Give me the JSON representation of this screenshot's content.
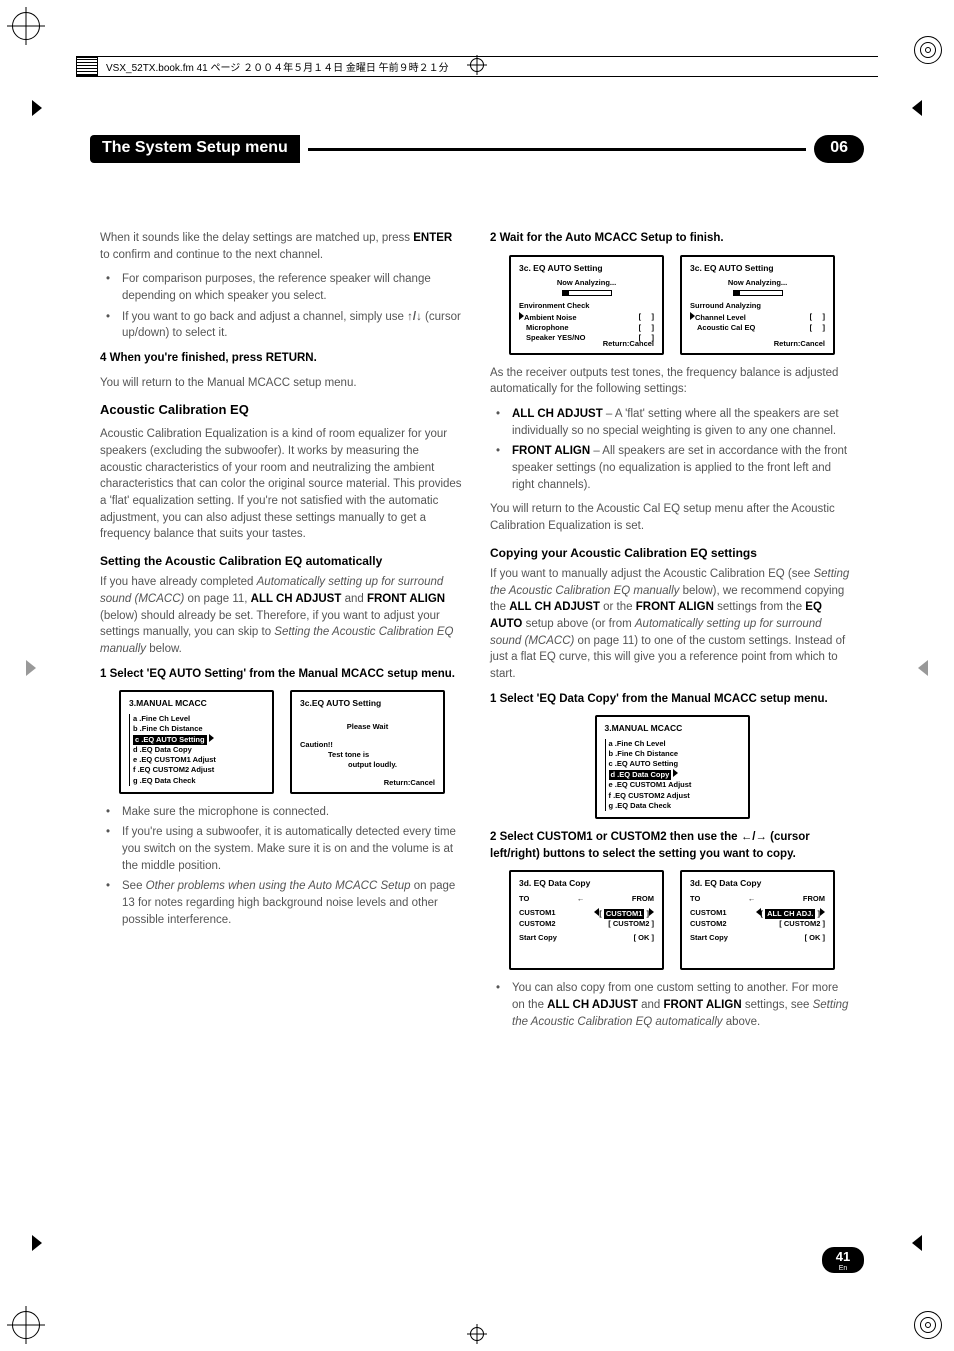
{
  "topstrip": "VSX_52TX.book.fm 41 ページ ２００４年５月１４日 金曜日 午前９時２１分",
  "title": "The System Setup menu",
  "chapter": "06",
  "pagenum": "41",
  "pagelang": "En",
  "left": {
    "intro1": "When it sounds like the delay settings are matched up, press ",
    "intro1b": "ENTER",
    "intro1c": " to confirm and continue to the next channel.",
    "b1": "For comparison purposes, the reference speaker will change depending on which speaker you select.",
    "b2a": "If you want to go back and adjust a channel, simply use ",
    "b2b": " (cursor up/down) to select it.",
    "s4": "4   When you're finished, press RETURN.",
    "s4p": "You will return to the Manual MCACC setup menu.",
    "h1": "Acoustic Calibration EQ",
    "p1": "Acoustic Calibration Equalization is a kind of room equalizer for your speakers (excluding the subwoofer). It works by measuring the acoustic characteristics of your room and neutralizing the ambient characteristics that can color the original source material. This provides a 'flat' equalization setting. If you're not satisfied with the automatic adjustment, you can also adjust these settings manually to get a frequency balance that suits your tastes.",
    "h2": "Setting the Acoustic Calibration EQ automatically",
    "p2a": "If you have already completed ",
    "p2b": "Automatically setting up for surround sound (MCACC)",
    "p2c": " on page 11, ",
    "p2d": "ALL CH ADJUST",
    "p2e": " and ",
    "p2f": "FRONT ALIGN",
    "p2g": " (below) should already be set. Therefore, if you want to adjust your settings manually, you can skip to ",
    "p2h": "Setting the Acoustic Calibration EQ manually",
    "p2i": " below.",
    "s1": "1   Select 'EQ AUTO Setting' from the Manual MCACC setup menu.",
    "scrA": {
      "title": "3.MANUAL MCACC",
      "a": "a .Fine Ch Level",
      "b": "b .Fine Ch Distance",
      "c": "c .EQ AUTO Setting",
      "d": "d .EQ Data Copy",
      "e": "e .EQ CUSTOM1 Adjust",
      "f": "f .EQ CUSTOM2 Adjust",
      "g": "g .EQ Data Check"
    },
    "scrB": {
      "title": "3c.EQ AUTO Setting",
      "wait": "Please Wait",
      "caution": "Caution!!",
      "t1": "Test tone is",
      "t2": "output loudly.",
      "ret": "Return:Cancel"
    },
    "b3": "Make sure the microphone is connected.",
    "b4": "If you're using a subwoofer, it is automatically detected every time you switch on the system. Make sure it is on and the volume is at the middle position.",
    "b5a": "See ",
    "b5b": "Other problems when using the Auto MCACC Setup",
    "b5c": " on page 13 for notes regarding high background noise levels and other possible interference."
  },
  "right": {
    "s2": "2   Wait for the Auto MCACC Setup to finish.",
    "scrC": {
      "title": "3c. EQ AUTO Setting",
      "now": "Now Analyzing...",
      "l1": "Environment Check",
      "l2": "Ambient Noise",
      "l3": "Microphone",
      "l4": "Speaker YES/NO",
      "ret": "Return:Cancel"
    },
    "scrD": {
      "title": "3c. EQ AUTO Setting",
      "now": "Now Analyzing...",
      "l1": "Surround Analyzing",
      "l2": "Channel Level",
      "l3": "Acoustic Cal EQ",
      "ret": "Return:Cancel"
    },
    "p1": "As the receiver outputs test tones, the frequency balance is adjusted automatically for the following settings:",
    "b1a": "ALL CH ADJUST",
    "b1b": " – A 'flat' setting where all the speakers are set individually so no special weighting is given to any one channel.",
    "b2a": "FRONT ALIGN",
    "b2b": " – All speakers are set in accordance with the front speaker settings (no equalization is applied to the front left and right channels).",
    "p2": "You will return to the Acoustic Cal EQ setup menu after the Acoustic Calibration Equalization is set.",
    "h1": "Copying your Acoustic Calibration EQ settings",
    "p3a": "If you want to manually adjust the Acoustic Calibration EQ (see ",
    "p3b": "Setting the Acoustic Calibration EQ manually",
    "p3c": " below), we recommend copying the ",
    "p3d": "ALL CH ADJUST",
    "p3e": " or the ",
    "p3f": "FRONT ALIGN",
    "p3g": " settings from the ",
    "p3h": "EQ AUTO",
    "p3i": " setup above (or from ",
    "p3j": "Automatically setting up for surround sound (MCACC)",
    "p3k": " on page 11) to one of the custom settings. Instead of just a flat EQ curve, this will give you a reference point from which to start.",
    "s1b": "1   Select 'EQ Data Copy' from the Manual MCACC setup menu.",
    "scrE": {
      "title": "3.MANUAL MCACC",
      "a": "a .Fine Ch Level",
      "b": "b .Fine Ch Distance",
      "c": "c .EQ AUTO Setting",
      "d": "d .EQ Data Copy",
      "e": "e .EQ CUSTOM1 Adjust",
      "f": "f .EQ CUSTOM2 Adjust",
      "g": "g .EQ Data Check"
    },
    "s2b_a": "2   Select CUSTOM1 or CUSTOM2 then use the ",
    "s2b_b": " (cursor left/right) buttons to select the setting you want to copy.",
    "scrF": {
      "title": "3d. EQ Data Copy",
      "to": "TO",
      "from": "FROM",
      "c1": "CUSTOM1",
      "c2": "CUSTOM2",
      "sc": "Start Copy",
      "ok": "[  OK  ]"
    },
    "scrG": {
      "title": "3d. EQ Data Copy",
      "to": "TO",
      "from": "FROM",
      "c1": "CUSTOM1",
      "c2": "CUSTOM2",
      "all": "ALL CH ADJ.",
      "sc": "Start Copy",
      "ok": "[  OK  ]"
    },
    "b3a": "You can also copy from one custom setting to another. For more on the ",
    "b3b": "ALL CH ADJUST",
    "b3c": " and ",
    "b3d": "FRONT ALIGN",
    "b3e": " settings, see ",
    "b3f": "Setting the Acoustic Calibration EQ automatically",
    "b3g": " above."
  }
}
